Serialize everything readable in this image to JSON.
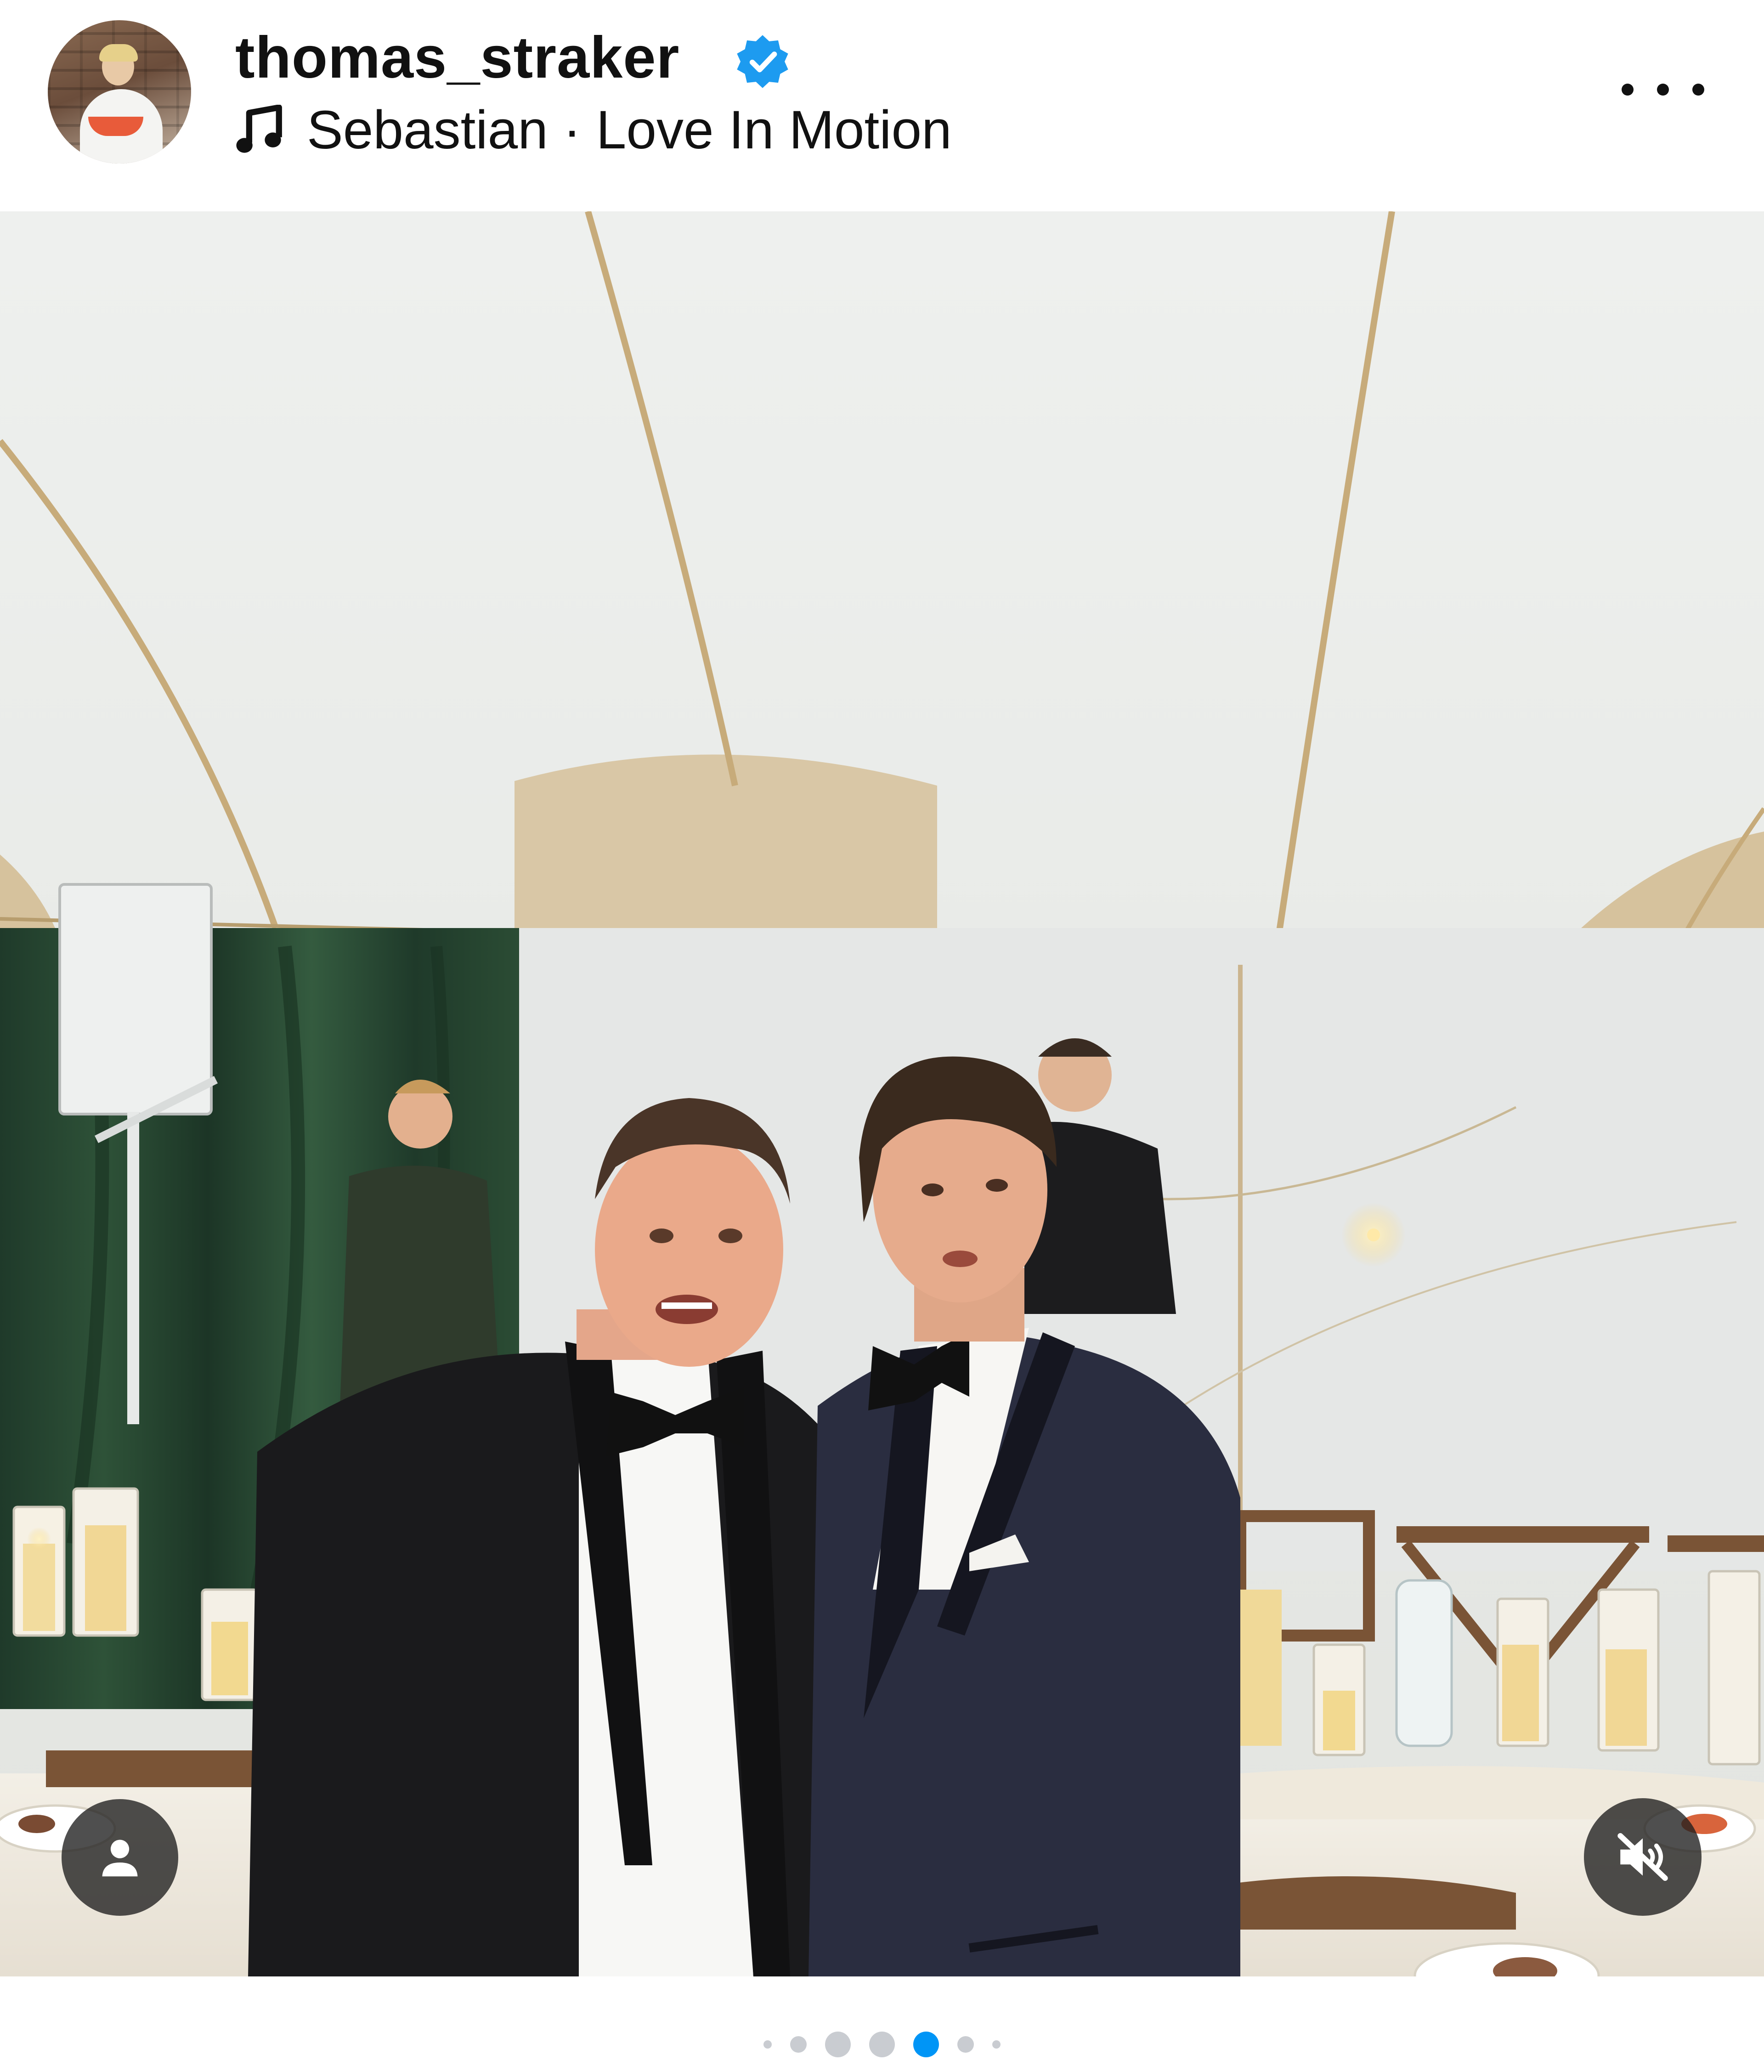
{
  "post": {
    "username": "thomas_straker",
    "verified": true,
    "audio_artist": "Sebastian",
    "audio_separator": " · ",
    "audio_title": "Love In Motion"
  },
  "icons": {
    "verified": "verified-badge-icon",
    "music": "music-note-icon",
    "more": "more-options-icon",
    "user_tags": "user-tags-icon",
    "mute": "speaker-muted-icon"
  },
  "carousel": {
    "total_dots": 7,
    "active_index": 4
  },
  "colors": {
    "verified_blue": "#1d9bf0",
    "active_dot": "#0095f6",
    "inactive_dot": "#c9ccd1"
  }
}
